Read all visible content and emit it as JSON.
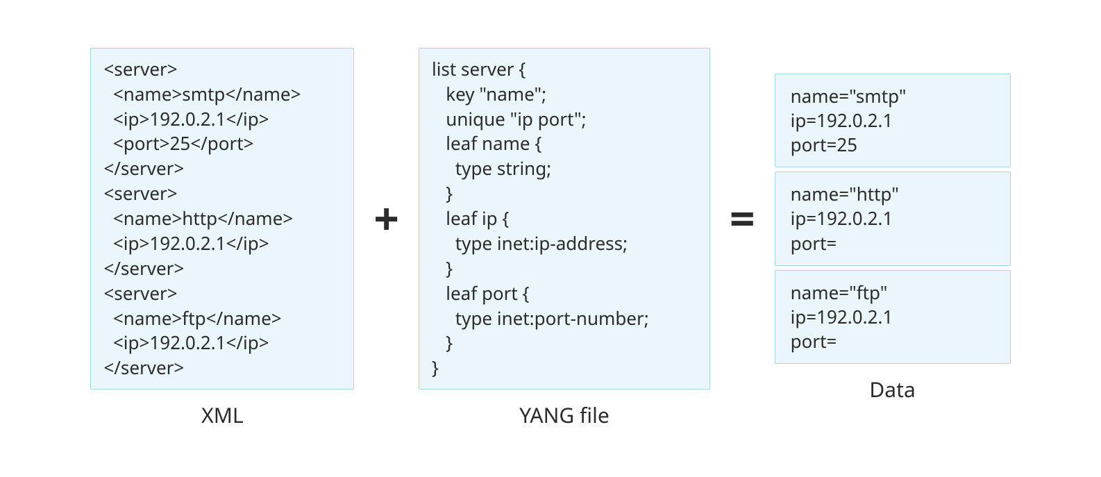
{
  "captions": {
    "xml": "XML",
    "yang": "YANG file",
    "data": "Data"
  },
  "operators": {
    "plus": "+",
    "equals": "="
  },
  "xml_code": "<server>\n  <name>smtp</name>\n  <ip>192.0.2.1</ip>\n  <port>25</port>\n</server>\n<server>\n  <name>http</name>\n  <ip>192.0.2.1</ip>\n</server>\n<server>\n  <name>ftp</name>\n  <ip>192.0.2.1</ip>\n</server>",
  "yang_code": "list server {\n   key \"name\";\n   unique \"ip port\";\n   leaf name {\n     type string;\n   }\n   leaf ip {\n     type inet:ip-address;\n   }\n   leaf port {\n     type inet:port-number;\n   }\n}",
  "data_entries": [
    "name=\"smtp\"\nip=192.0.2.1\nport=25",
    "name=\"http\"\nip=192.0.2.1\nport=",
    "name=\"ftp\"\nip=192.0.2.1\nport="
  ]
}
